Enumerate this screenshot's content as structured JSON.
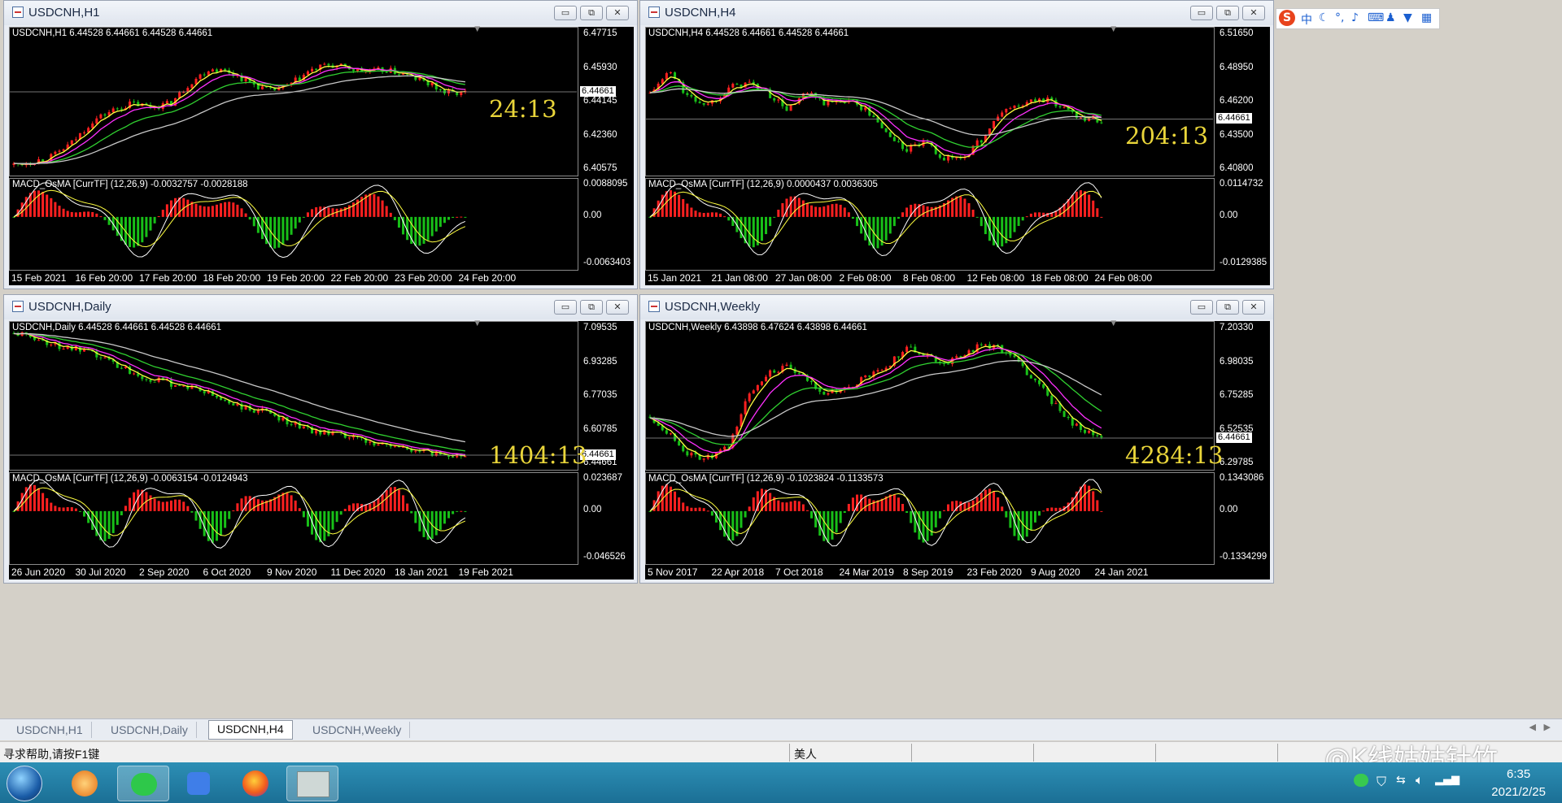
{
  "windows": [
    {
      "id": "h1",
      "title": "USDCNH,H1",
      "header": "USDCNH,H1  6.44528 6.44661 6.44528 6.44661",
      "prices": [
        "6.47715",
        "6.45930",
        "6.44145",
        "6.42360",
        "6.40575"
      ],
      "current": "6.44661",
      "timer": "24:13",
      "macd_header": "MACD_OsMA [CurrTF] (12,26,9) -0.0032757 -0.0028188",
      "macd_scale": [
        "0.0088095",
        "0.00",
        "-0.0063403"
      ],
      "xlabels": [
        "15 Feb 2021",
        "16 Feb 20:00",
        "17 Feb 20:00",
        "18 Feb 20:00",
        "19 Feb 20:00",
        "22 Feb 20:00",
        "23 Feb 20:00",
        "24 Feb 20:00"
      ],
      "price_path": [
        6.405,
        6.407,
        6.41,
        6.418,
        6.43,
        6.436,
        6.44,
        6.438,
        6.44,
        6.452,
        6.46,
        6.458,
        6.452,
        6.447,
        6.45,
        6.458,
        6.462,
        6.46,
        6.458,
        6.459,
        6.456,
        6.452,
        6.446,
        6.446
      ],
      "price_range": [
        6.4022,
        6.4799
      ]
    },
    {
      "id": "h4",
      "title": "USDCNH,H4",
      "header": "USDCNH,H4  6.44528 6.44661 6.44528 6.44661",
      "prices": [
        "6.51650",
        "6.48950",
        "6.46200",
        "6.43500",
        "6.40800"
      ],
      "current": "6.44661",
      "timer": "204:13",
      "macd_header": "MACD_OsMA [CurrTF] (12,26,9) 0.0000437 0.0036305",
      "macd_scale": [
        "0.0114732",
        "0.00",
        "-0.0129385"
      ],
      "xlabels": [
        "15 Jan 2021",
        "21 Jan 08:00",
        "27 Jan 08:00",
        "2 Feb 08:00",
        "8 Feb 08:00",
        "12 Feb 08:00",
        "18 Feb 08:00",
        "24 Feb 08:00"
      ],
      "price_path": [
        6.47,
        6.49,
        6.465,
        6.46,
        6.475,
        6.48,
        6.47,
        6.455,
        6.47,
        6.46,
        6.465,
        6.455,
        6.435,
        6.418,
        6.425,
        6.41,
        6.412,
        6.43,
        6.455,
        6.46,
        6.465,
        6.458,
        6.448,
        6.446
      ],
      "price_range": [
        6.4,
        6.525
      ]
    },
    {
      "id": "daily",
      "title": "USDCNH,Daily",
      "header": "USDCNH,Daily  6.44528 6.44661 6.44528 6.44661",
      "prices": [
        "7.09535",
        "6.93285",
        "6.77035",
        "6.60785",
        "6.44661"
      ],
      "current": "6.44661",
      "timer": "1404:13",
      "macd_header": "MACD_OsMA [CurrTF] (12,26,9) -0.0063154 -0.0124943",
      "macd_scale": [
        "0.023687",
        "0.00",
        "-0.046526"
      ],
      "xlabels": [
        "26 Jun 2020",
        "30 Jul 2020",
        "2 Sep 2020",
        "6 Oct 2020",
        "9 Nov 2020",
        "11 Dec 2020",
        "18 Jan 2021",
        "19 Feb 2021"
      ],
      "price_path": [
        7.08,
        7.06,
        7.02,
        7.0,
        6.97,
        6.93,
        6.88,
        6.84,
        6.82,
        6.8,
        6.76,
        6.72,
        6.68,
        6.67,
        6.62,
        6.58,
        6.56,
        6.54,
        6.52,
        6.5,
        6.48,
        6.46,
        6.45,
        6.446
      ],
      "price_range": [
        6.4,
        7.11
      ]
    },
    {
      "id": "weekly",
      "title": "USDCNH,Weekly",
      "header": "USDCNH,Weekly  6.43898 6.47624 6.43898 6.44661",
      "prices": [
        "7.20330",
        "6.98035",
        "6.75285",
        "6.52535",
        "6.29785"
      ],
      "current": "6.44661",
      "timer": "4284:13",
      "macd_header": "MACD_OsMA [CurrTF] (12,26,9) -0.1023824 -0.1133573",
      "macd_scale": [
        "0.1343086",
        "0.00",
        "-0.1334299"
      ],
      "xlabels": [
        "5 Nov 2017",
        "22 Apr 2018",
        "7 Oct 2018",
        "24 Mar 2019",
        "8 Sep 2019",
        "23 Feb 2020",
        "9 Aug 2020",
        "24 Jan 2021"
      ],
      "price_path": [
        6.6,
        6.48,
        6.32,
        6.3,
        6.38,
        6.75,
        6.92,
        6.95,
        6.86,
        6.76,
        6.8,
        6.88,
        6.95,
        7.1,
        7.05,
        6.98,
        7.05,
        7.12,
        7.08,
        6.95,
        6.8,
        6.62,
        6.5,
        6.446
      ],
      "price_range": [
        6.26,
        7.24
      ]
    }
  ],
  "tabs": [
    "USDCNH,H1",
    "USDCNH,Daily",
    "USDCNH,H4",
    "USDCNH,Weekly"
  ],
  "active_tab": "USDCNH,H4",
  "status": {
    "help": "寻求帮助,请按F1键",
    "profile": "美人"
  },
  "clock": {
    "time": "6:35",
    "date": "2021/2/25"
  },
  "watermark": "@K线姑姑针竹",
  "ime": {
    "logo": "S",
    "mode": "中"
  },
  "window_buttons": {
    "minimize": "▭",
    "restore": "⧉",
    "close": "✕"
  },
  "icons": [
    "start-orb-icon",
    "media-player-icon",
    "wechat-icon",
    "edit-pen-icon",
    "firefox-icon",
    "trading-terminal-icon",
    "wechat-tray-icon",
    "shield-tray-icon",
    "network-tray-icon",
    "volume-tray-icon",
    "signal-tray-icon"
  ],
  "colors": {
    "bull": "#ff2020",
    "bear": "#18c018",
    "ma_fast": "#ffff40",
    "ma_mid": "#ff30ff",
    "ma_slow": "#30d030",
    "ma_long": "#c8c8c8",
    "timer": "#e9d53a"
  }
}
